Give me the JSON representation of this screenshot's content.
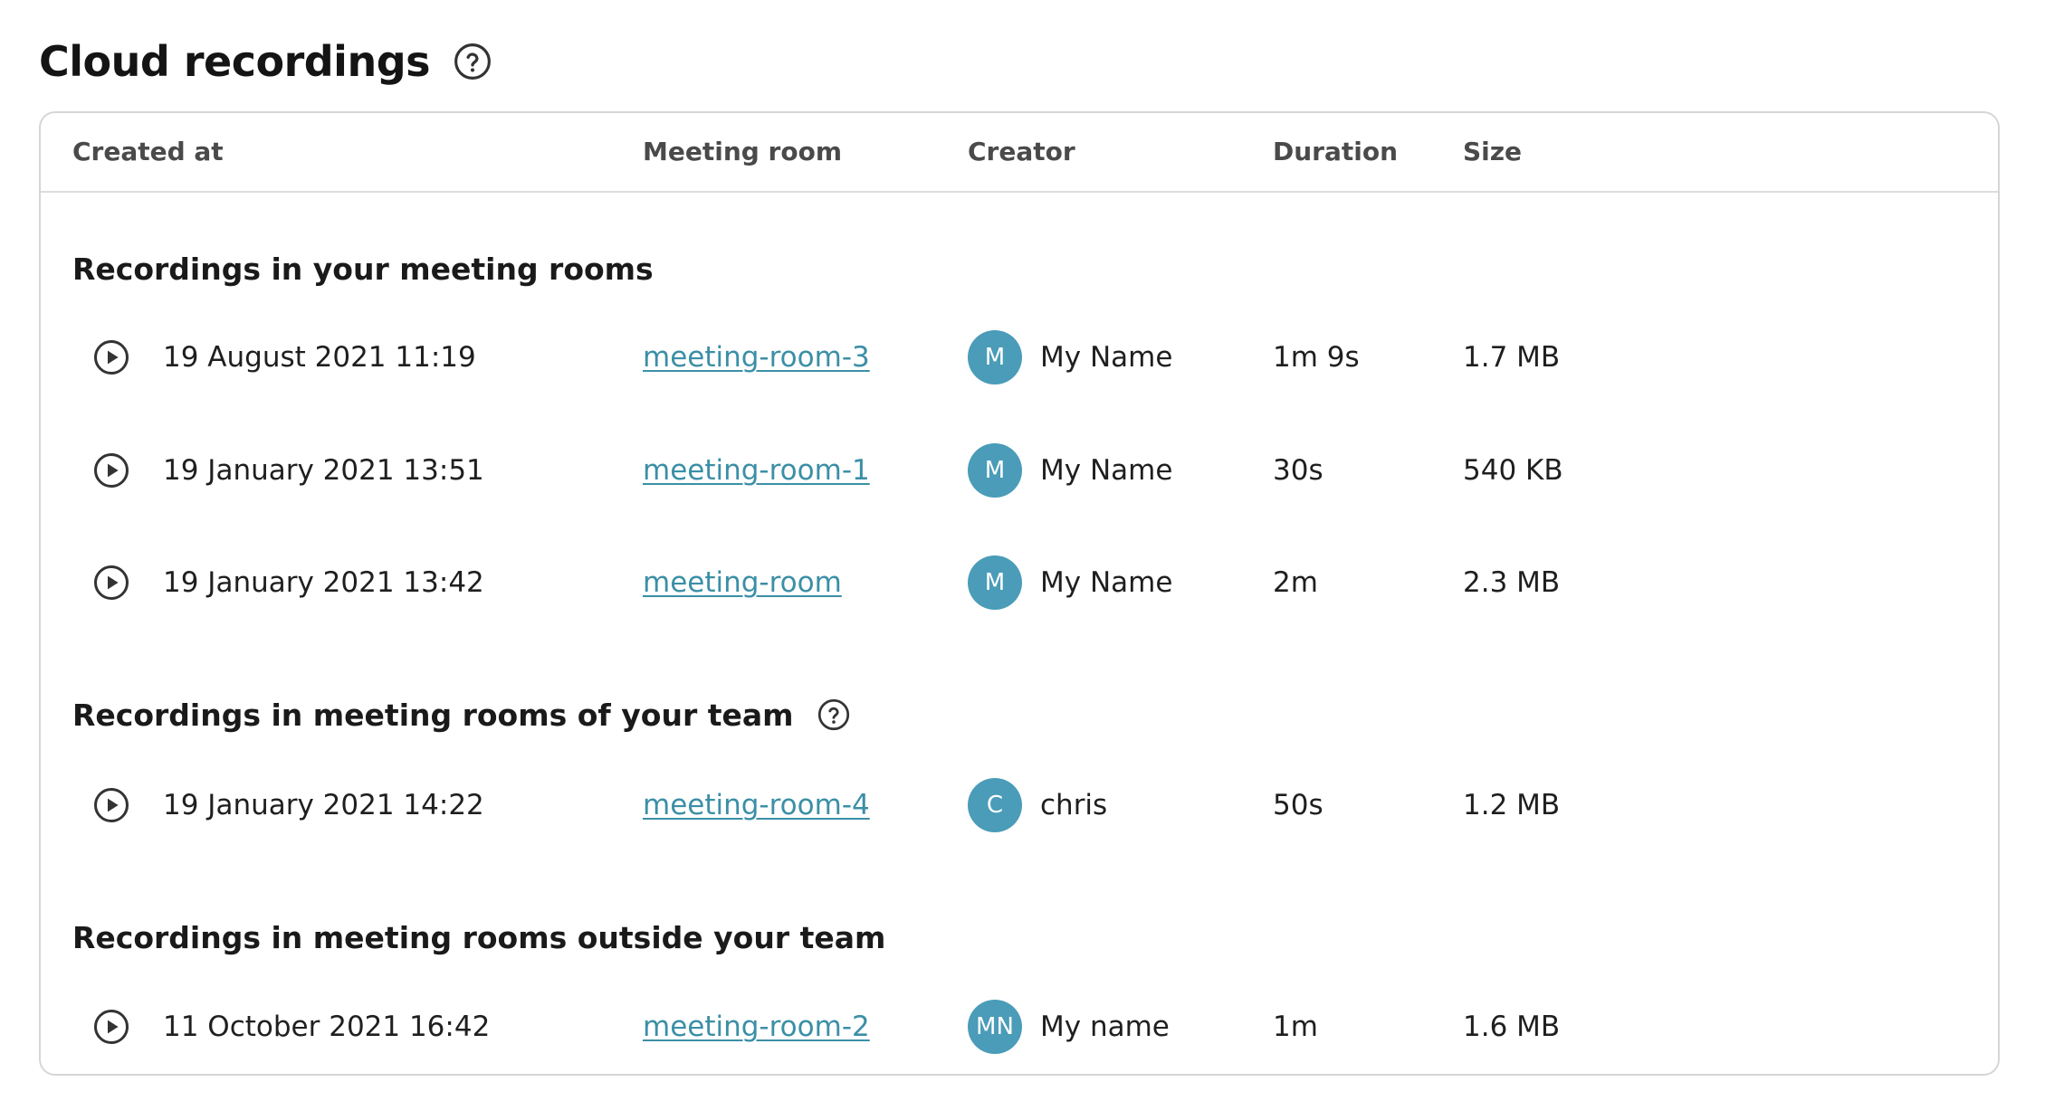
{
  "page": {
    "title": "Cloud recordings"
  },
  "icons": {
    "help": "help-circle-icon",
    "play": "play-circle-icon"
  },
  "colors": {
    "accent": "#3b8fa6",
    "avatar": "#4a9cb8",
    "border": "#d6d6d6",
    "icon": "#333333"
  },
  "table": {
    "headers": {
      "created_at": "Created at",
      "meeting_room": "Meeting room",
      "creator": "Creator",
      "duration": "Duration",
      "size": "Size"
    }
  },
  "sections": [
    {
      "title": "Recordings in your meeting rooms",
      "rows": [
        {
          "created_at": "19 August 2021 11:19",
          "room": "meeting-room-3",
          "avatar": "M",
          "creator": "My Name",
          "duration": "1m 9s",
          "size": "1.7 MB"
        },
        {
          "created_at": "19 January 2021 13:51",
          "room": "meeting-room-1",
          "avatar": "M",
          "creator": "My Name",
          "duration": "30s",
          "size": "540 KB"
        },
        {
          "created_at": "19 January 2021 13:42",
          "room": "meeting-room",
          "avatar": "M",
          "creator": "My Name",
          "duration": "2m",
          "size": "2.3 MB"
        }
      ]
    },
    {
      "title": "Recordings in meeting rooms of your team",
      "rows": [
        {
          "created_at": "19 January 2021 14:22",
          "room": "meeting-room-4",
          "avatar": "C",
          "creator": "chris",
          "duration": "50s",
          "size": "1.2 MB"
        }
      ]
    },
    {
      "title": "Recordings in meeting rooms outside your team",
      "rows": [
        {
          "created_at": "11 October 2021 16:42",
          "room": "meeting-room-2",
          "avatar": "MN",
          "creator": "My name",
          "duration": "1m",
          "size": "1.6 MB"
        }
      ]
    }
  ]
}
